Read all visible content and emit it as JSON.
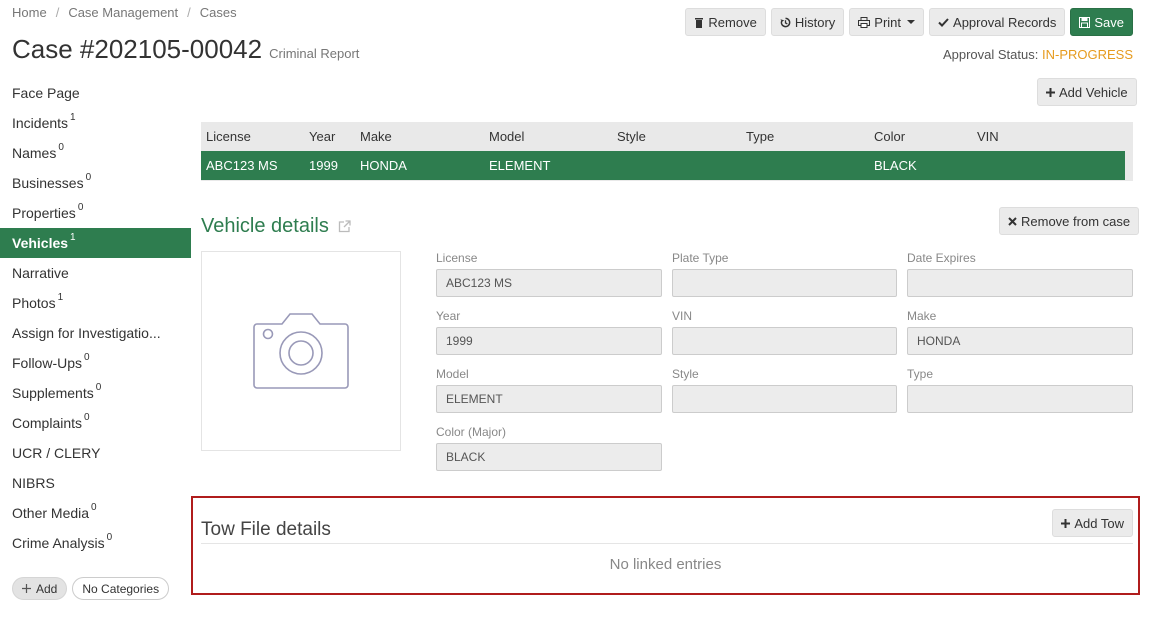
{
  "breadcrumb": [
    "Home",
    "Case Management",
    "Cases"
  ],
  "case": {
    "title": "Case #202105-00042",
    "type": "Criminal Report"
  },
  "toolbar": {
    "remove": "Remove",
    "history": "History",
    "print": "Print",
    "approval": "Approval Records",
    "save": "Save"
  },
  "approval": {
    "label": "Approval Status:",
    "value": "IN-PROGRESS"
  },
  "sidebar": {
    "items": [
      {
        "label": "Face Page",
        "count": ""
      },
      {
        "label": "Incidents",
        "count": "1"
      },
      {
        "label": "Names",
        "count": "0"
      },
      {
        "label": "Businesses",
        "count": "0"
      },
      {
        "label": "Properties",
        "count": "0"
      },
      {
        "label": "Vehicles",
        "count": "1"
      },
      {
        "label": "Narrative",
        "count": ""
      },
      {
        "label": "Photos",
        "count": "1"
      },
      {
        "label": "Assign for Investigatio...",
        "count": ""
      },
      {
        "label": "Follow-Ups",
        "count": "0"
      },
      {
        "label": "Supplements",
        "count": "0"
      },
      {
        "label": "Complaints",
        "count": "0"
      },
      {
        "label": "UCR / CLERY",
        "count": ""
      },
      {
        "label": "NIBRS",
        "count": ""
      },
      {
        "label": "Other Media",
        "count": "0"
      },
      {
        "label": "Crime Analysis",
        "count": "0"
      }
    ],
    "add": "Add",
    "categories": "No Categories"
  },
  "vehicles": {
    "add_label": "Add Vehicle",
    "columns": [
      "License",
      "Year",
      "Make",
      "Model",
      "Style",
      "Type",
      "Color",
      "VIN"
    ],
    "rows": [
      [
        "ABC123 MS",
        "1999",
        "HONDA",
        "ELEMENT",
        "",
        "",
        "BLACK",
        ""
      ]
    ]
  },
  "details": {
    "title": "Vehicle details",
    "remove_label": "Remove from case",
    "fields": {
      "license": {
        "label": "License",
        "value": "ABC123  MS"
      },
      "plate_type": {
        "label": "Plate Type",
        "value": ""
      },
      "date_expires": {
        "label": "Date Expires",
        "value": ""
      },
      "year": {
        "label": "Year",
        "value": "1999"
      },
      "vin": {
        "label": "VIN",
        "value": ""
      },
      "make": {
        "label": "Make",
        "value": "HONDA"
      },
      "model": {
        "label": "Model",
        "value": "ELEMENT"
      },
      "style": {
        "label": "Style",
        "value": ""
      },
      "type": {
        "label": "Type",
        "value": ""
      },
      "color": {
        "label": "Color (Major)",
        "value": "BLACK"
      }
    }
  },
  "tow": {
    "title": "Tow File details",
    "add_label": "Add Tow",
    "empty": "No linked entries"
  },
  "colors": {
    "accent": "#2e7d4f",
    "status": "#e69b1e",
    "highlight_border": "#b01c1c"
  }
}
